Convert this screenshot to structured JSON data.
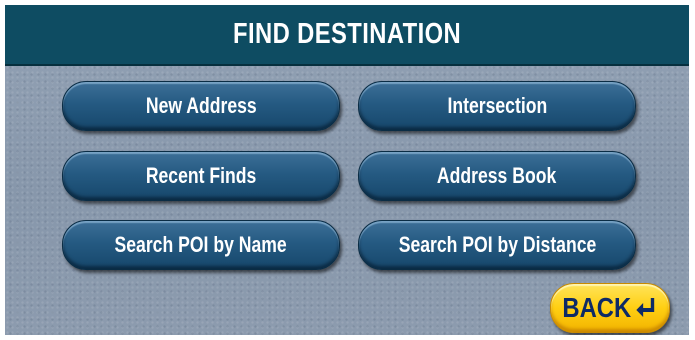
{
  "header": {
    "title": "FIND DESTINATION"
  },
  "menu": {
    "items": [
      {
        "label": "New Address"
      },
      {
        "label": "Intersection"
      },
      {
        "label": "Recent Finds"
      },
      {
        "label": "Address Book"
      },
      {
        "label": "Search POI by Name"
      },
      {
        "label": "Search POI by Distance"
      }
    ]
  },
  "footer": {
    "back_label": "BACK",
    "back_icon": "return-arrow-icon"
  },
  "colors": {
    "title_bar": "#0e4c62",
    "button_blue": "#255a82",
    "back_yellow": "#ffcf12",
    "back_text": "#0e2a66",
    "background": "#8e9db0"
  }
}
